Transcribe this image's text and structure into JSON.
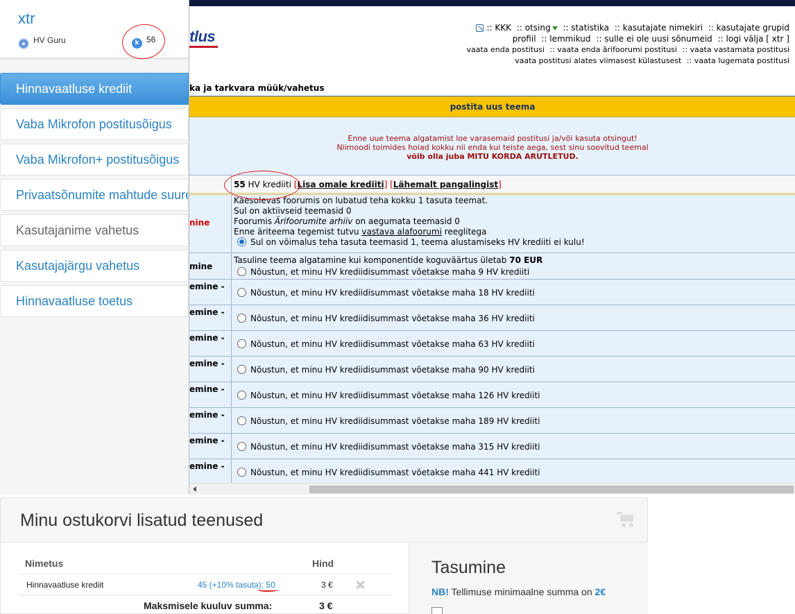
{
  "profile": {
    "username": "xtr",
    "rank": "HV Guru",
    "credits": "56"
  },
  "sidebar_menu": [
    "Hinnavaatluse krediit",
    "Vaba Mikrofon postitusõigus",
    "Vaba Mikrofon+ postitusõigus",
    "Privaatsõnumite mahtude suure",
    "Kasutajanime vahetus",
    "Kasutajajärgu vahetus",
    "Hinnavaatluse toetus"
  ],
  "forum": {
    "logo_fragment": "tlus",
    "nav": {
      "row1": [
        ":: KKK",
        ":: otsing",
        ":: statistika",
        ":: kasutajate nimekiri",
        ":: kasutajate grupid"
      ],
      "row2": [
        "profiil",
        ":: lemmikud",
        ":: sulle ei ole uusi sõnumeid",
        ":: logi välja [ xtr ]"
      ],
      "row3": [
        "vaata enda postitusi",
        ":: vaata enda ärifoorumi postitusi",
        ":: vaata vastamata postitusi"
      ],
      "row4": [
        "vaata postitusi alates viimasest külastusest",
        ":: vaata lugemata postitusi"
      ]
    },
    "breadcrumb": "ka ja tarkvara müük/vahetus",
    "table_title": "postita uus teema",
    "warning": {
      "line1": "Enne uue teema algatamist loe varasemaid postitusi ja/või kasuta otsingut!",
      "line2": "Niimoodi toimides hoiad kokku nii enda kui teiste aega, sest sinu soovitud teemal",
      "line3": "võib olla juba MITU KORDA ARUTLETUD."
    },
    "credit_row": {
      "amount": "55",
      "unit": "HV krediiti",
      "link1": "Lisa omale krediiti",
      "link2": "Lähemalt pangalingist"
    },
    "free_row": {
      "label": "nine",
      "line1": "Käesolevas foorumis on lubatud teha kokku 1 tasuta teemat.",
      "line2": "Sul on aktiivseid teemasid 0",
      "line3_pre": "Foorumis ",
      "line3_em": "Ärifoorumite arhiiv",
      "line3_post": " on aegumata teemasid 0",
      "line4_pre": "Enne äriteema tegemist tutvu ",
      "line4_link": "vastava alafoorumi",
      "line4_post": " reeglitega",
      "option": "Sul on võimalus teha tasuta teemasid 1, teema alustamiseks HV krediiti ei kulu!"
    },
    "paid_first": {
      "label": "mine",
      "info_pre": "Tasuline teema algatamine kui komponentide koguväärtus ületab ",
      "info_bold": "70 EUR",
      "option": "Nõustun, et minu HV krediidisummast võetakse maha 9 HV krediiti"
    },
    "paid_label": "emine -",
    "paid_options": [
      "Nõustun, et minu HV krediidisummast võetakse maha 18 HV krediiti",
      "Nõustun, et minu HV krediidisummast võetakse maha 36 HV krediiti",
      "Nõustun, et minu HV krediidisummast võetakse maha 63 HV krediiti",
      "Nõustun, et minu HV krediidisummast võetakse maha 90 HV krediiti",
      "Nõustun, et minu HV krediidisummast võetakse maha 126 HV krediiti",
      "Nõustun, et minu HV krediidisummast võetakse maha 189 HV krediiti",
      "Nõustun, et minu HV krediidisummast võetakse maha 315 HV krediiti",
      "Nõustun, et minu HV krediidisummast võetakse maha 441 HV krediiti"
    ]
  },
  "cart": {
    "title": "Minu ostukorvi lisatud teenused",
    "col_name": "Nimetus",
    "col_price": "Hind",
    "item_name": "Hinnavaatluse krediit",
    "item_qty": "45 (+10% tasuta): 50",
    "item_price": "3 €",
    "total_label": "Maksmisele kuuluv summa:",
    "total_value": "3 €"
  },
  "payment": {
    "title": "Tasumine",
    "nb": "NB!",
    "min_text": "Tellimuse minimaalne summa on",
    "min_value": "2€"
  },
  "colors": {
    "accent": "#2a83c4",
    "header_yellow": "#f7c200",
    "annotation_red": "#e0191b"
  }
}
